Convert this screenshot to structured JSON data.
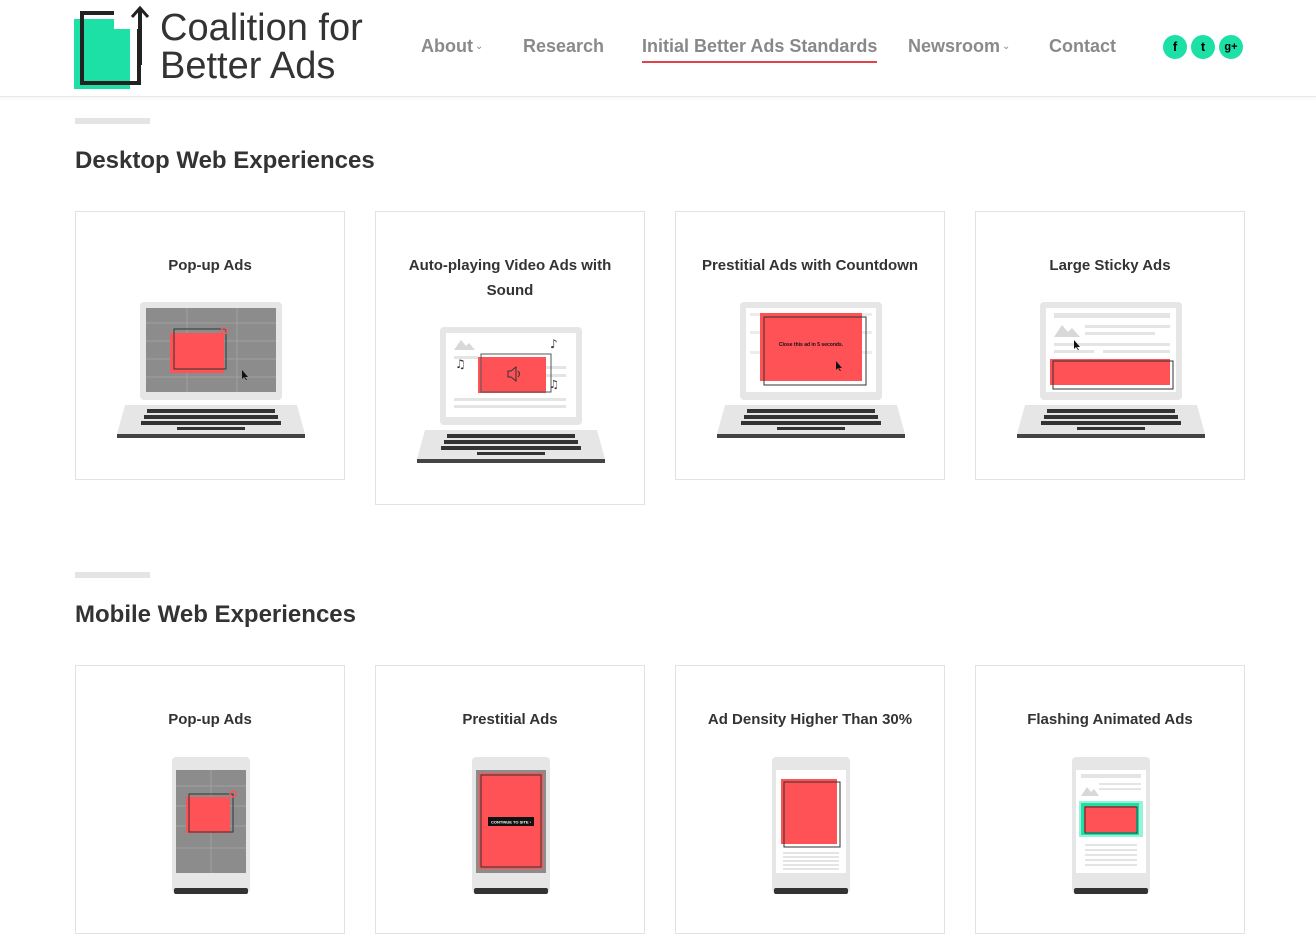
{
  "brand": {
    "name_line1": "Coalition for",
    "name_line2": "Better Ads",
    "accent": "#1de0a6"
  },
  "nav": {
    "items": [
      {
        "label": "About",
        "has_dropdown": true
      },
      {
        "label": "Research",
        "has_dropdown": false
      },
      {
        "label": "Initial Better Ads Standards",
        "has_dropdown": false,
        "active": true
      },
      {
        "label": "Newsroom",
        "has_dropdown": true
      },
      {
        "label": "Contact",
        "has_dropdown": false
      }
    ],
    "dropdown_glyph": "⌄"
  },
  "social": {
    "facebook": "f",
    "twitter": "t",
    "googleplus": "g+"
  },
  "sections": {
    "desktop": {
      "title": "Desktop Web Experiences",
      "cards": [
        {
          "title": "Pop-up Ads",
          "icon": "laptop-popup-ad-icon"
        },
        {
          "title": "Auto-playing Video Ads with Sound",
          "icon": "laptop-autoplay-video-icon"
        },
        {
          "title": "Prestitial Ads with Countdown",
          "icon": "laptop-prestitial-countdown-icon",
          "overlay_text": "Close this ad in 5 seconds."
        },
        {
          "title": "Large Sticky Ads",
          "icon": "laptop-sticky-ad-icon"
        }
      ]
    },
    "mobile": {
      "title": "Mobile Web Experiences",
      "cards": [
        {
          "title": "Pop-up Ads",
          "icon": "phone-popup-ad-icon"
        },
        {
          "title": "Prestitial Ads",
          "icon": "phone-prestitial-icon",
          "overlay_text": "CONTINUE TO SITE ›"
        },
        {
          "title": "Ad Density Higher Than 30%",
          "icon": "phone-ad-density-icon"
        },
        {
          "title": "Flashing Animated Ads",
          "icon": "phone-flashing-ad-icon"
        }
      ]
    }
  },
  "colors": {
    "ad_red": "#ff5256",
    "active_underline": "#e0444a",
    "nav_text": "#8a8a8a"
  }
}
